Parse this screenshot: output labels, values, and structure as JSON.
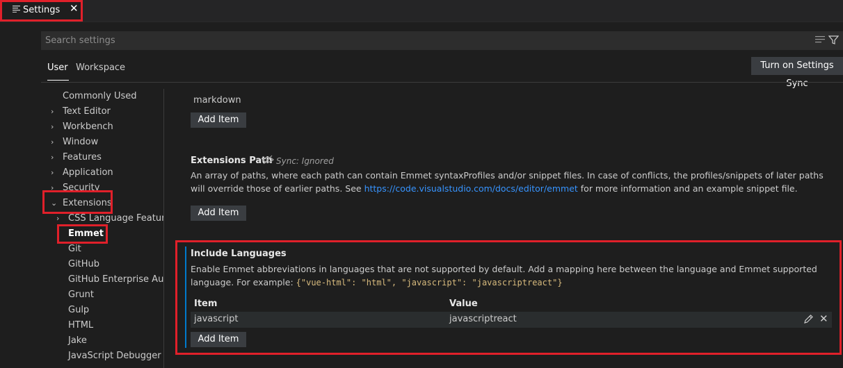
{
  "tab": {
    "label": "Settings",
    "icon": "settings-lines-icon",
    "close": "✕"
  },
  "search": {
    "placeholder": "Search settings"
  },
  "scopes": {
    "user": "User",
    "workspace": "Workspace",
    "sync_button": "Turn on Settings Sync"
  },
  "toc": {
    "items": [
      {
        "label": "Commonly Used",
        "chevron": ""
      },
      {
        "label": "Text Editor",
        "chevron": "›"
      },
      {
        "label": "Workbench",
        "chevron": "›"
      },
      {
        "label": "Window",
        "chevron": "›"
      },
      {
        "label": "Features",
        "chevron": "›"
      },
      {
        "label": "Application",
        "chevron": "›"
      },
      {
        "label": "Security",
        "chevron": "›"
      },
      {
        "label": "Extensions",
        "chevron": "⌄"
      }
    ],
    "sub_items": [
      {
        "label": "CSS Language Features",
        "chevron": "›"
      },
      {
        "label": "Emmet",
        "chevron": ""
      },
      {
        "label": "Git",
        "chevron": ""
      },
      {
        "label": "GitHub",
        "chevron": ""
      },
      {
        "label": "GitHub Enterprise Aut...",
        "chevron": ""
      },
      {
        "label": "Grunt",
        "chevron": ""
      },
      {
        "label": "Gulp",
        "chevron": ""
      },
      {
        "label": "HTML",
        "chevron": ""
      },
      {
        "label": "Jake",
        "chevron": ""
      },
      {
        "label": "JavaScript Debugger",
        "chevron": ""
      }
    ]
  },
  "content": {
    "prev_list_value": "markdown",
    "add_item": "Add Item",
    "extensions_path": {
      "title": "Extensions Path",
      "sync_note": "Sync: Ignored",
      "desc_before": "An array of paths, where each path can contain Emmet syntaxProfiles and/or snippet files. In case of conflicts, the profiles/snippets of later paths will override those of earlier paths. See ",
      "link": "https://code.visualstudio.com/docs/editor/emmet",
      "desc_after": " for more information and an example snippet file."
    },
    "include_languages": {
      "title": "Include Languages",
      "desc": "Enable Emmet abbreviations in languages that are not supported by default. Add a mapping here between the language and Emmet supported language. For example: ",
      "example": "{\"vue-html\": \"html\", \"javascript\": \"javascriptreact\"}",
      "col_item": "Item",
      "col_value": "Value",
      "rows": [
        {
          "item": "javascript",
          "value": "javascriptreact"
        }
      ]
    }
  },
  "colors": {
    "accent": "#007acc",
    "highlight_border": "#e0202a",
    "link": "#3794ff"
  }
}
